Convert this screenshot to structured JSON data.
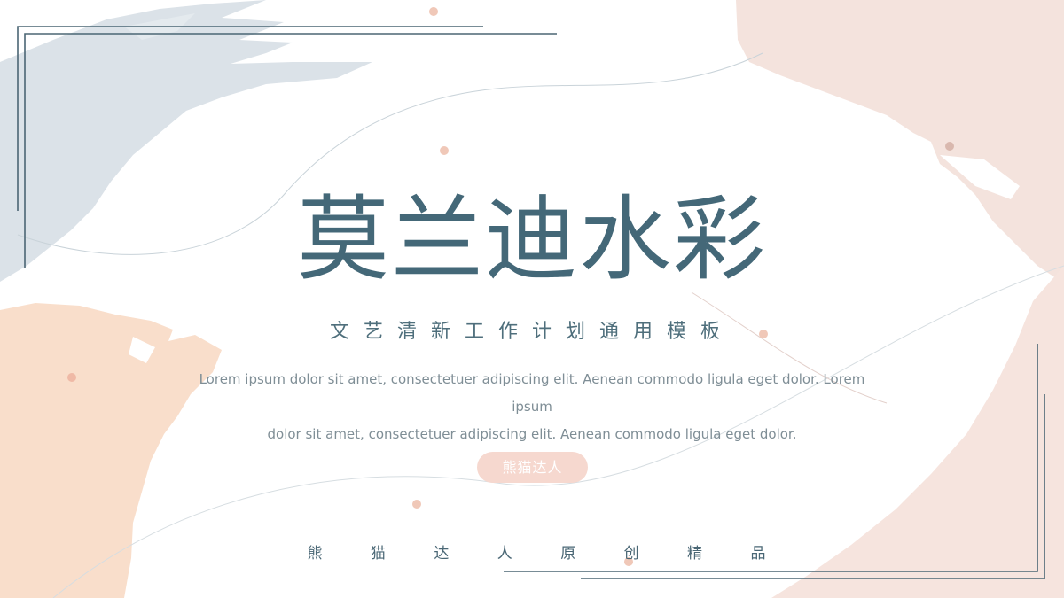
{
  "slide": {
    "title": "莫兰迪水彩",
    "subtitle": "文艺清新工作计划通用模板",
    "description_line1": "Lorem ipsum dolor sit amet, consectetuer adipiscing elit. Aenean commodo ligula eget dolor. Lorem ipsum",
    "description_line2": "dolor sit amet, consectetuer adipiscing elit. Aenean commodo ligula eget dolor.",
    "author": "熊猫达人",
    "footer_chars": [
      "熊",
      "猫",
      "达",
      "人",
      "原",
      "创",
      "精",
      "品"
    ]
  },
  "colors": {
    "title": "#446878",
    "blue_grey_wash": "#d9e1e7",
    "peach_wash": "#f8dcc8",
    "pink_wash": "#f3e2dc",
    "dot": "#f0c8b8",
    "frame_line": "#4b6674"
  }
}
